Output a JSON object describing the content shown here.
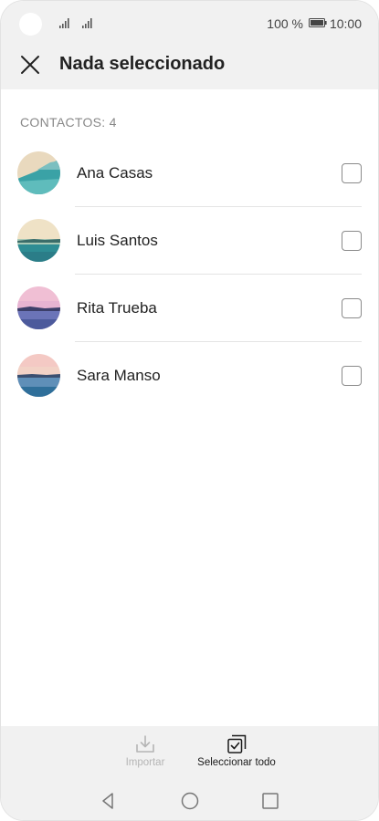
{
  "status_bar": {
    "battery_percent": "100 %",
    "time": "10:00",
    "icons": [
      "signal-icon",
      "signal-icon",
      "battery-icon"
    ]
  },
  "header": {
    "title": "Nada seleccionado",
    "close_icon": "close-icon"
  },
  "contacts": {
    "section_label": "CONTACTOS: 4",
    "items": [
      {
        "name": "Ana Casas",
        "checked": false,
        "avatar_colors": [
          "#e9d9be",
          "#3aa2a6"
        ]
      },
      {
        "name": "Luis Santos",
        "checked": false,
        "avatar_colors": [
          "#efe2c6",
          "#2e8d94"
        ]
      },
      {
        "name": "Rita Trueba",
        "checked": false,
        "avatar_colors": [
          "#f0bfd4",
          "#4c5a9c"
        ]
      },
      {
        "name": "Sara Manso",
        "checked": false,
        "avatar_colors": [
          "#f4c9c4",
          "#2f6f9a"
        ]
      }
    ]
  },
  "toolbar": {
    "import_label": "Importar",
    "import_enabled": false,
    "select_all_label": "Seleccionar todo",
    "import_icon": "import-icon",
    "select_all_icon": "select-all-icon"
  },
  "navigation": {
    "icons": [
      "back-icon",
      "home-icon",
      "recents-icon"
    ]
  }
}
